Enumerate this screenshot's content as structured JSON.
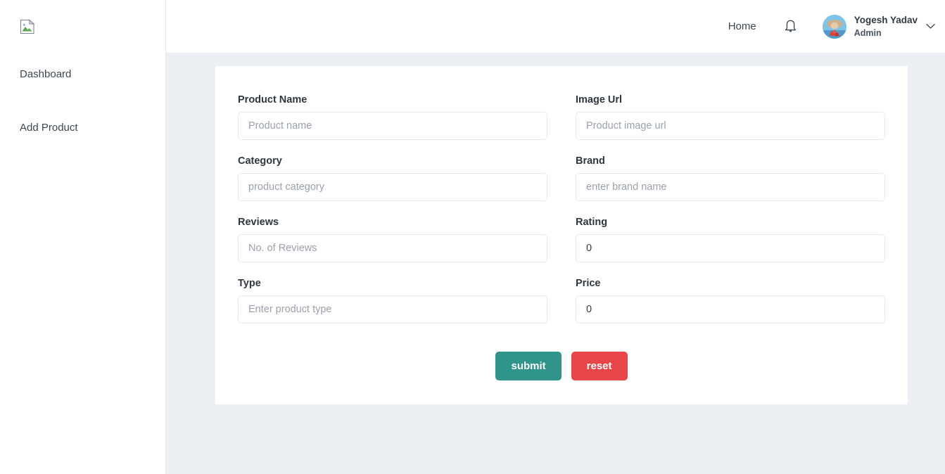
{
  "sidebar": {
    "logo": {
      "icon": "broken-image-icon",
      "alt": ""
    },
    "items": [
      {
        "label": "Dashboard",
        "name": "sidebar-item-dashboard"
      },
      {
        "label": "Add Product",
        "name": "sidebar-item-add-product"
      }
    ]
  },
  "header": {
    "home_label": "Home",
    "notification_icon": "bell-icon",
    "avatar_icon": "avatar",
    "user_name": "Yogesh Yadav",
    "user_role": "Admin",
    "chevron_icon": "chevron-down-icon"
  },
  "form": {
    "fields": [
      {
        "label": "Product Name",
        "placeholder": "Product name",
        "value": ""
      },
      {
        "label": "Image Url",
        "placeholder": "Product image url",
        "value": ""
      },
      {
        "label": "Category",
        "placeholder": "product category",
        "value": ""
      },
      {
        "label": "Brand",
        "placeholder": "enter brand name",
        "value": ""
      },
      {
        "label": "Reviews",
        "placeholder": "No. of Reviews",
        "value": ""
      },
      {
        "label": "Rating",
        "placeholder": "",
        "value": "0"
      },
      {
        "label": "Type",
        "placeholder": "Enter product type",
        "value": ""
      },
      {
        "label": "Price",
        "placeholder": "",
        "value": "0"
      }
    ],
    "submit_label": "submit",
    "reset_label": "reset"
  },
  "colors": {
    "submit": "#2f9489",
    "reset": "#e8464a",
    "page_bg": "#eceff3",
    "card_bg": "#ffffff"
  }
}
